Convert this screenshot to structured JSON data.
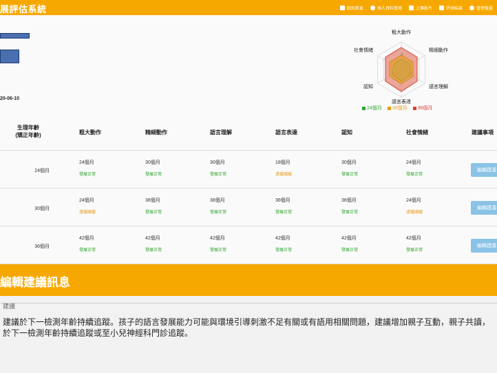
{
  "header": {
    "brand": "展評估系統",
    "nav": [
      {
        "label": "回到首頁",
        "icon": "home-icon"
      },
      {
        "label": "個人資料管理",
        "icon": "user-icon"
      },
      {
        "label": "上傳影片",
        "icon": "upload-icon"
      },
      {
        "label": "評測結果",
        "icon": "result-icon"
      },
      {
        "label": "管理後臺",
        "icon": "gear-icon"
      }
    ]
  },
  "profile": {
    "date": "20-06-10"
  },
  "radar": {
    "axes": [
      "粗大動作",
      "精細動作",
      "語言理解",
      "語言表達",
      "認知",
      "社會情緒"
    ],
    "scale_label": "36",
    "legend": [
      {
        "label": "24個月",
        "color": "#2ea62e"
      },
      {
        "label": "30個月",
        "color": "#e89a1c"
      },
      {
        "label": "36個月",
        "color": "#d9433a"
      }
    ]
  },
  "table": {
    "headers": {
      "age_line1": "生理年齡",
      "age_line2": "(矯正年齡)",
      "domains": [
        "粗大動作",
        "精細動作",
        "語言理解",
        "語言表達",
        "認知",
        "社會情緒"
      ],
      "advice": "建議事項"
    },
    "rows": [
      {
        "age": "24個月",
        "cells": [
          {
            "month": "24個月",
            "status": "發展正常",
            "ok": true
          },
          {
            "month": "30個月",
            "status": "發展正常",
            "ok": true
          },
          {
            "month": "30個月",
            "status": "發展正常",
            "ok": true
          },
          {
            "month": "18個月",
            "status": "遠緩國緩",
            "ok": false
          },
          {
            "month": "30個月",
            "status": "發展正常",
            "ok": true
          },
          {
            "month": "24個月",
            "status": "發展正常",
            "ok": true
          }
        ],
        "button": "編輯建議"
      },
      {
        "age": "30個月",
        "cells": [
          {
            "month": "24個月",
            "status": "遠緩國緩",
            "ok": false
          },
          {
            "month": "36個月",
            "status": "發展正常",
            "ok": true
          },
          {
            "month": "36個月",
            "status": "發展正常",
            "ok": true
          },
          {
            "month": "36個月",
            "status": "發展正常",
            "ok": true
          },
          {
            "month": "36個月",
            "status": "發展正常",
            "ok": true
          },
          {
            "month": "24個月",
            "status": "遠緩國緩",
            "ok": false
          }
        ],
        "button": "編輯建議"
      },
      {
        "age": "36個月",
        "cells": [
          {
            "month": "42個月",
            "status": "發展正常",
            "ok": true
          },
          {
            "month": "42個月",
            "status": "發展正常",
            "ok": true
          },
          {
            "month": "42個月",
            "status": "發展正常",
            "ok": true
          },
          {
            "month": "42個月",
            "status": "發展正常",
            "ok": true
          },
          {
            "month": "42個月",
            "status": "發展正常",
            "ok": true
          },
          {
            "month": "42個月",
            "status": "發展正常",
            "ok": true
          }
        ],
        "button": "編輯建議"
      }
    ]
  },
  "edit": {
    "title": "編輯建議訊息",
    "field_label": "建議",
    "text": "建議於下一檢測年齡持續追蹤。孩子的語言發展能力可能與環境引導刺激不足有關或有語用相關問題，建議增加親子互動，親子共讀，於下一檢測年齡持續追蹤或至小兒神經科門診追蹤。"
  },
  "colors": {
    "accent": "#f7a800",
    "ok": "#2ea62e",
    "slow": "#e89a1c",
    "button": "#8ac3e6"
  }
}
